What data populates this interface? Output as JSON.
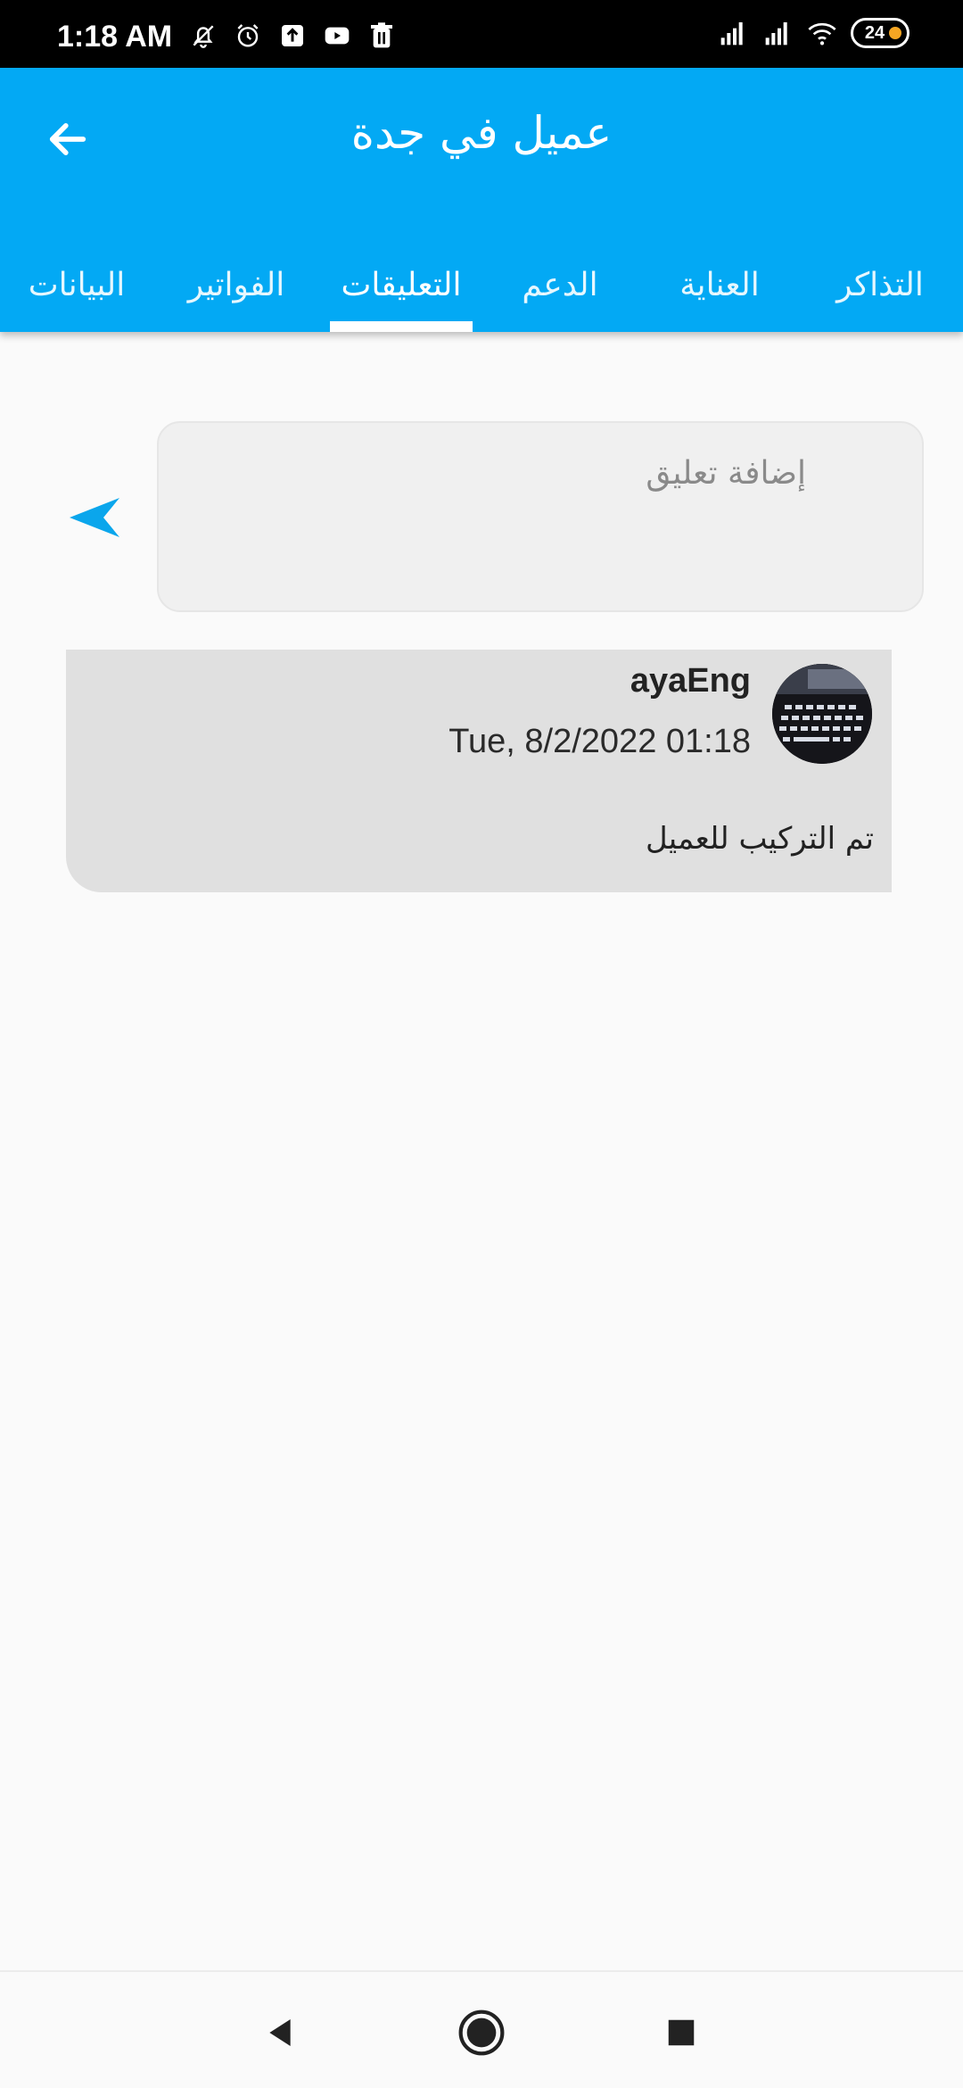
{
  "status_bar": {
    "time": "1:18 AM",
    "battery": "24",
    "left_icons": [
      "bell-off-icon",
      "alarm-icon",
      "upload-icon",
      "youtube-icon",
      "trash-icon"
    ],
    "right_icons": [
      "signal-icon",
      "signal-icon",
      "wifi-icon",
      "battery-icon"
    ]
  },
  "app_bar": {
    "title": "عميل في جدة",
    "back_icon": "arrow-back-icon",
    "color": "#03a9f4"
  },
  "tabs": [
    {
      "label": "التذاكر",
      "active": false
    },
    {
      "label": "العناية",
      "active": false
    },
    {
      "label": "الدعم",
      "active": false
    },
    {
      "label": "التعليقات",
      "active": true
    },
    {
      "label": "الفواتير",
      "active": false
    },
    {
      "label": "البيانات",
      "active": false
    }
  ],
  "composer": {
    "placeholder": "إضافة تعليق",
    "value": "",
    "send_icon": "send-icon"
  },
  "comments": [
    {
      "user": "ayaEng",
      "date": "Tue, 8/2/2022 01:18",
      "text": "تم التركيب للعميل",
      "avatar_icon": "avatar-icon"
    }
  ],
  "nav_bar": {
    "icons": [
      "nav-back-icon",
      "nav-home-icon",
      "nav-recents-icon"
    ]
  }
}
